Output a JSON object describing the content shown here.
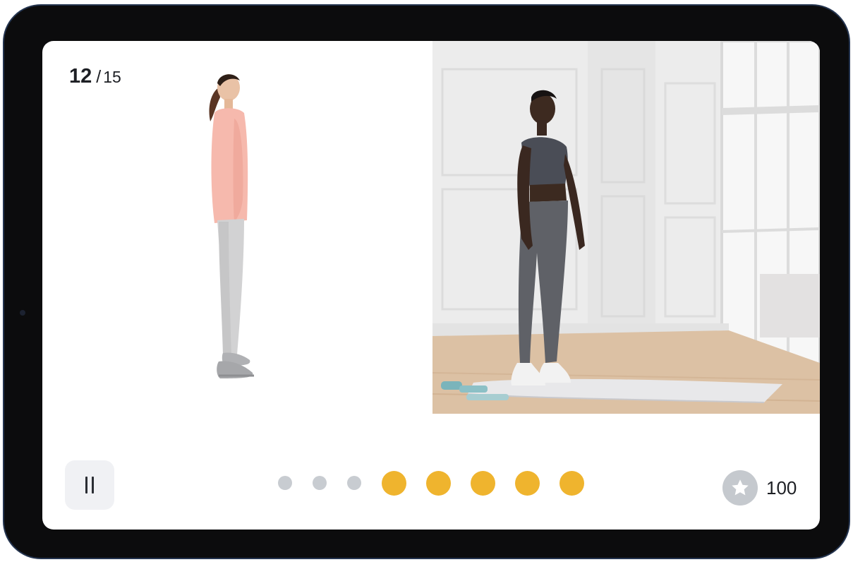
{
  "workout": {
    "current_exercise": "12",
    "separator": "/",
    "total_exercises": "15"
  },
  "controls": {
    "pause_icon": "pause-icon"
  },
  "progress": {
    "pending_steps": 3,
    "completed_steps": 5,
    "colors": {
      "pending": "#c8ccd1",
      "completed": "#efb42e"
    }
  },
  "score": {
    "icon": "star-icon",
    "value": "100"
  },
  "colors": {
    "device_frame": "#0c0c0d",
    "frame_border": "#24344f",
    "accent": "#efb42e"
  }
}
